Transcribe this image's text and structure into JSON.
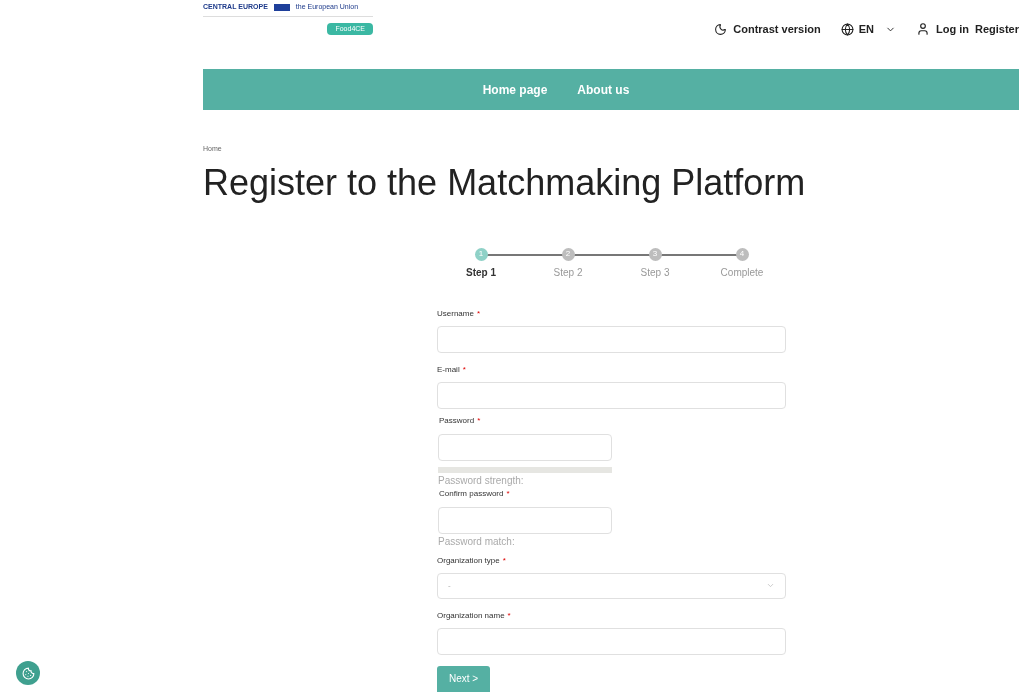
{
  "header": {
    "logo_texts": [
      "CENTRAL EUROPE",
      "the European Union",
      "Food4CE"
    ],
    "contrast": "Contrast version",
    "language": "EN",
    "login": "Log in",
    "register": "Register"
  },
  "nav": [
    "Home page",
    "About us"
  ],
  "breadcrumb": "Home",
  "title": "Register to the Matchmaking Platform",
  "steps": [
    {
      "number": "1",
      "label": "Step 1",
      "selected": true
    },
    {
      "number": "2",
      "label": "Step 2",
      "selected": false
    },
    {
      "number": "3",
      "label": "Step 3",
      "selected": false
    },
    {
      "number": "4",
      "label": "Complete",
      "selected": false
    }
  ],
  "fields": [
    {
      "kind": "text",
      "label": "Username",
      "required_mark": "*"
    },
    {
      "kind": "text",
      "label": "E-mail",
      "required_mark": "*"
    },
    {
      "kind": "password",
      "label": "Password",
      "required_mark": "*",
      "meter": {
        "caption": "Password strength:"
      }
    },
    {
      "kind": "password",
      "label": "Confirm password",
      "required_mark": "*",
      "caption": "Password match:"
    },
    {
      "kind": "select",
      "label": "Organization type",
      "required_mark": "*",
      "value": "-"
    },
    {
      "kind": "text",
      "label": "Organization name",
      "required_mark": "*"
    }
  ],
  "next_button": "Next >"
}
